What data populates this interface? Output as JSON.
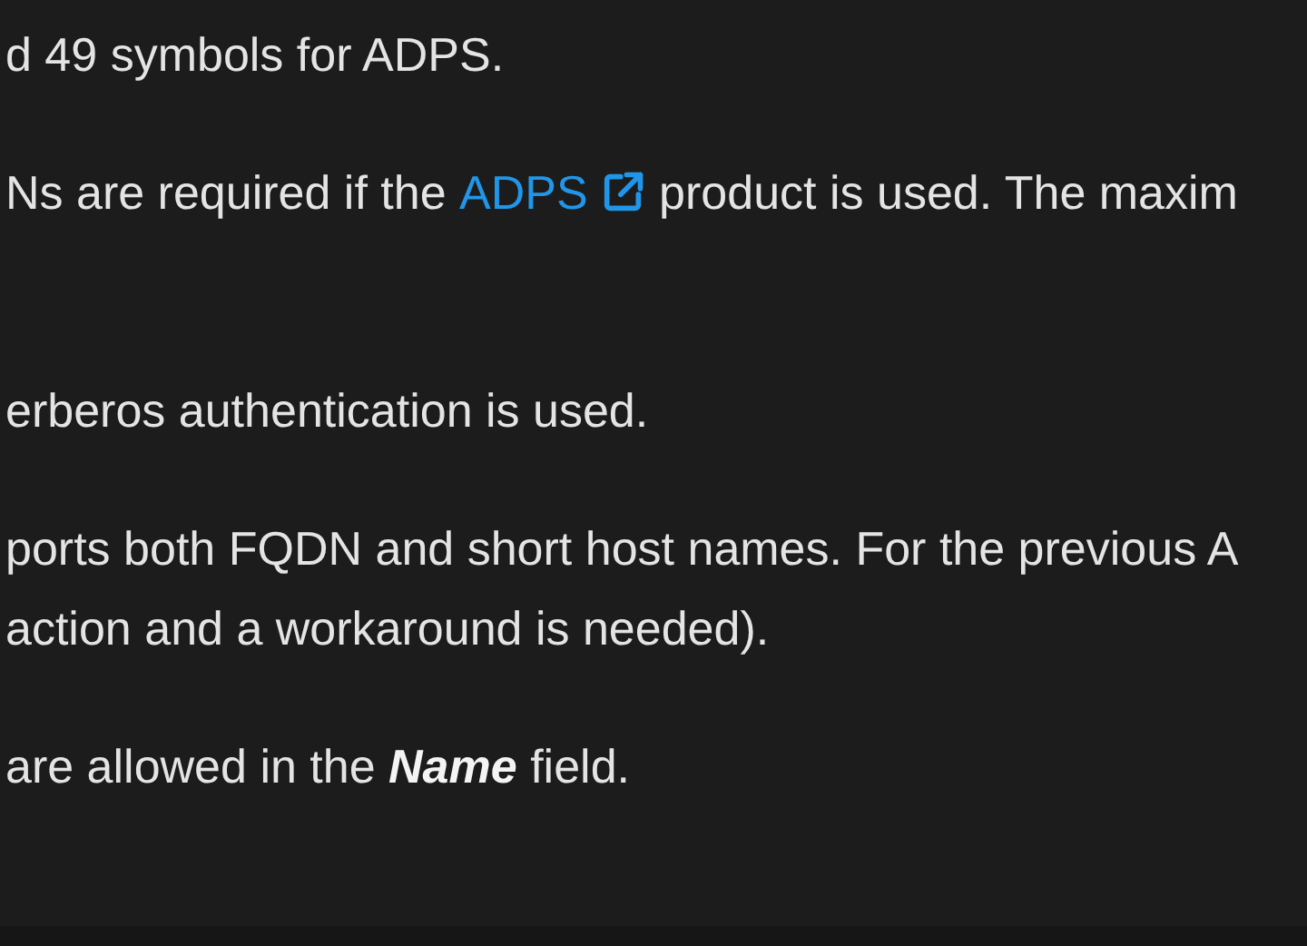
{
  "paragraphs": [
    {
      "lines": [
        [
          {
            "kind": "text",
            "text": "d 49 symbols for ADPS."
          }
        ]
      ]
    },
    {
      "lines": [
        [
          {
            "kind": "text",
            "text": "Ns are required if the "
          },
          {
            "kind": "link",
            "text": "ADPS",
            "external": true
          },
          {
            "kind": "text",
            "text": " product is used. The maxim"
          }
        ]
      ]
    },
    {
      "lines": [
        [
          {
            "kind": "text",
            "text": "erberos authentication is used."
          }
        ]
      ]
    },
    {
      "lines": [
        [
          {
            "kind": "text",
            "text": "ports both FQDN and short host names. For the previous A"
          }
        ],
        [
          {
            "kind": "text",
            "text": "action and a workaround is needed)."
          }
        ]
      ]
    },
    {
      "lines": [
        [
          {
            "kind": "text",
            "text": "are allowed in the **Name** field."
          }
        ]
      ]
    }
  ]
}
